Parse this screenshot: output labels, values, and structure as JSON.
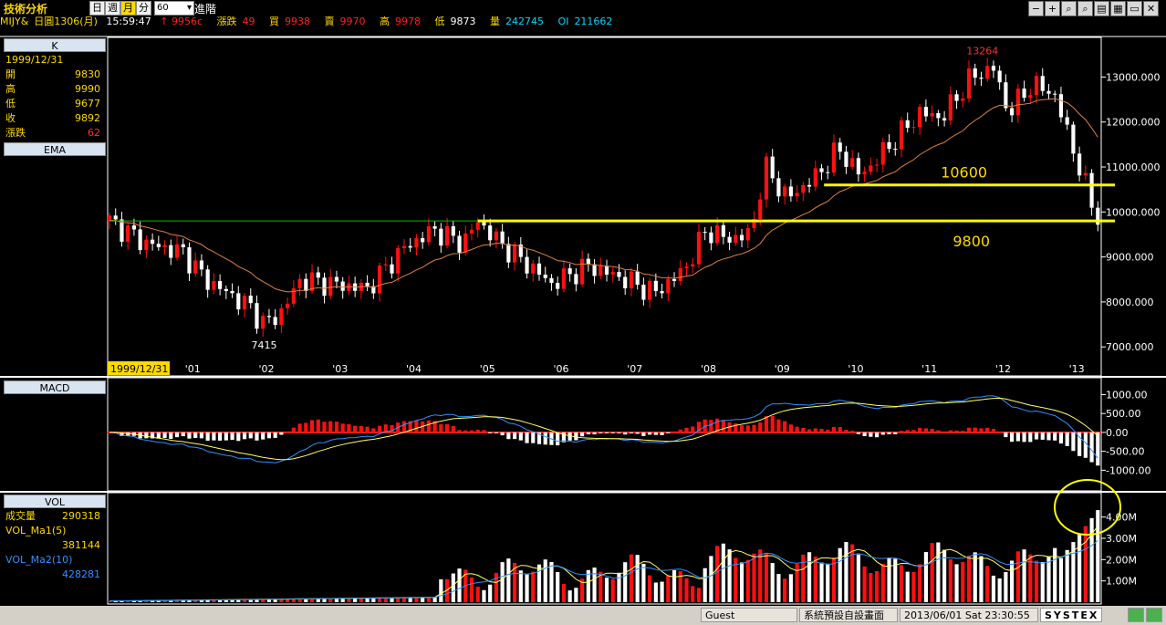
{
  "toolbar": {
    "title": "技術分析",
    "period_buttons": [
      "日",
      "週",
      "月",
      "分"
    ],
    "selected_period": "月",
    "interval_value": "60",
    "advanced_label": "進階",
    "window_buttons": [
      "−",
      "+",
      "⌕",
      "⌕",
      "▤",
      "▦",
      "▭",
      "✕"
    ]
  },
  "quote": {
    "symbol": "MIJY&",
    "chart_name": "日圓1306(月)",
    "time": "15:59:47",
    "last": "9956c",
    "change_label": "漲跌",
    "change": "49",
    "bid_label": "買",
    "bid": "9938",
    "ask_label": "賣",
    "ask": "9970",
    "high_label": "高",
    "high": "9978",
    "low_label": "低",
    "low": "9873",
    "vol_label": "量",
    "volume": "242745",
    "oi_label": "OI",
    "oi": "211662"
  },
  "info_panel": {
    "k_header": "K",
    "date": "1999/12/31",
    "rows": [
      {
        "label": "開",
        "value": "9830"
      },
      {
        "label": "高",
        "value": "9990"
      },
      {
        "label": "低",
        "value": "9677"
      },
      {
        "label": "收",
        "value": "9892"
      },
      {
        "label": "漲跌",
        "value": "62"
      }
    ],
    "ema_header": "EMA",
    "macd_header": "MACD",
    "vol_header": "VOL",
    "vol_rows": [
      {
        "label": "成交量",
        "value": "290318"
      },
      {
        "label": "VOL_Ma1(5)",
        "value": ""
      },
      {
        "label": "",
        "value": "381144"
      },
      {
        "label": "VOL_Ma2(10)",
        "value": ""
      },
      {
        "label": "",
        "value": "428281"
      }
    ]
  },
  "chart_data": {
    "type": "candlestick",
    "price_axis": {
      "ticks": [
        "13000.000",
        "12000.000",
        "11000.000",
        "10000.000",
        "9000.000",
        "8000.000",
        "7000.000"
      ],
      "ylim": [
        6700,
        13800
      ]
    },
    "x_labels": [
      "'01",
      "'02",
      "'03",
      "'04",
      "'05",
      "'06",
      "'07",
      "'08",
      "'09",
      "'10",
      "'11",
      "'12",
      "'13"
    ],
    "cursor_date": "1999/12/31",
    "annotations": [
      {
        "text": "13264",
        "value": 13264,
        "color": "#ff3030"
      },
      {
        "text": "7415",
        "value": 7415,
        "color": "#ffffff"
      },
      {
        "text": "10600",
        "value": 10600,
        "color": "#ffd800"
      },
      {
        "text": "9800",
        "value": 9800,
        "color": "#ffd800"
      }
    ],
    "horizontal_lines": [
      {
        "value": 10600,
        "color": "#ffff00",
        "from_year": 2009.7
      },
      {
        "value": 9800,
        "color": "#ffff00",
        "from_year": 2005.0
      },
      {
        "value": 9800,
        "color": "#00c000",
        "from_year": 2000.0
      }
    ],
    "price_series": [
      {
        "t": 2000.0,
        "c": 9800
      },
      {
        "t": 2000.5,
        "c": 9300
      },
      {
        "t": 2001.0,
        "c": 9100
      },
      {
        "t": 2001.3,
        "c": 8500
      },
      {
        "t": 2001.6,
        "c": 8200
      },
      {
        "t": 2001.9,
        "c": 7900
      },
      {
        "t": 2002.1,
        "c": 7500
      },
      {
        "t": 2002.3,
        "c": 7700
      },
      {
        "t": 2002.6,
        "c": 8500
      },
      {
        "t": 2003.0,
        "c": 8400
      },
      {
        "t": 2003.5,
        "c": 8300
      },
      {
        "t": 2004.0,
        "c": 9200
      },
      {
        "t": 2004.4,
        "c": 9600
      },
      {
        "t": 2004.8,
        "c": 9300
      },
      {
        "t": 2005.0,
        "c": 9800
      },
      {
        "t": 2005.3,
        "c": 9300
      },
      {
        "t": 2005.7,
        "c": 8800
      },
      {
        "t": 2006.0,
        "c": 8400
      },
      {
        "t": 2006.5,
        "c": 8800
      },
      {
        "t": 2007.0,
        "c": 8500
      },
      {
        "t": 2007.4,
        "c": 8200
      },
      {
        "t": 2007.8,
        "c": 8700
      },
      {
        "t": 2008.1,
        "c": 9600
      },
      {
        "t": 2008.4,
        "c": 9400
      },
      {
        "t": 2008.7,
        "c": 9500
      },
      {
        "t": 2008.9,
        "c": 11000
      },
      {
        "t": 2009.2,
        "c": 10300
      },
      {
        "t": 2009.6,
        "c": 10800
      },
      {
        "t": 2009.9,
        "c": 11400
      },
      {
        "t": 2010.2,
        "c": 10800
      },
      {
        "t": 2010.6,
        "c": 11500
      },
      {
        "t": 2011.0,
        "c": 12200
      },
      {
        "t": 2011.3,
        "c": 12100
      },
      {
        "t": 2011.7,
        "c": 13000
      },
      {
        "t": 2012.0,
        "c": 13200
      },
      {
        "t": 2012.2,
        "c": 12200
      },
      {
        "t": 2012.5,
        "c": 12800
      },
      {
        "t": 2012.8,
        "c": 12700
      },
      {
        "t": 2013.0,
        "c": 11800
      },
      {
        "t": 2013.2,
        "c": 10800
      },
      {
        "t": 2013.4,
        "c": 9900
      }
    ],
    "macd_axis": {
      "ticks": [
        "1000.00",
        "500.00",
        "0.00",
        "-500.00",
        "-1000.00"
      ],
      "ylim": [
        -1400,
        1300
      ]
    },
    "volume_axis": {
      "ticks": [
        "4.00M",
        "3.00M",
        "2.00M",
        "1.00M"
      ],
      "ylim": [
        0,
        4800000
      ]
    },
    "highlight_circle": {
      "note": "volume spike"
    }
  },
  "status_bar": {
    "user": "Guest",
    "layout": "系統預設自設畫面",
    "datetime": "2013/06/01 Sat 23:30:55",
    "brand": "SYSTEX"
  },
  "colors": {
    "up": "#ff1010",
    "down": "#ffffff",
    "ema": "#e08040",
    "macd_line": "#3090ff",
    "signal": "#ffff60",
    "grid": "#ffffff"
  }
}
